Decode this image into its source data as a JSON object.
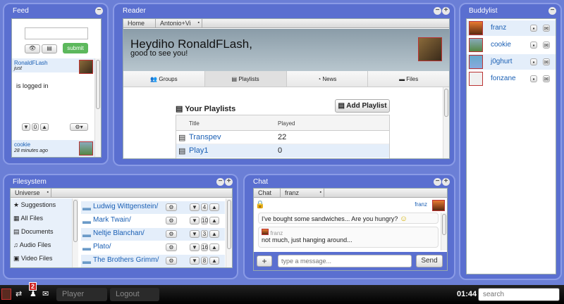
{
  "feed": {
    "title": "Feed",
    "submit": "submit",
    "items": [
      {
        "user": "RonaldFLash",
        "time": "just",
        "text": "is logged in",
        "likes": "0"
      },
      {
        "user": "cookie",
        "time": "28 minutes ago"
      }
    ]
  },
  "reader": {
    "title": "Reader",
    "tabs": [
      "Home",
      "Antonio+Vi"
    ],
    "greeting": "Heydiho RonaldFLash,",
    "sub": "good to see you!",
    "nav": [
      "Groups",
      "Playlists",
      "News",
      "Files"
    ],
    "section": "Your Playlists",
    "add": "Add Playlist",
    "cols": [
      "Title",
      "Played"
    ],
    "rows": [
      {
        "title": "Transpev",
        "played": "22"
      },
      {
        "title": "Play1",
        "played": "0"
      }
    ]
  },
  "buddylist": {
    "title": "Buddylist",
    "buddies": [
      "franz",
      "cookie",
      "j0ghurt",
      "fonzane"
    ]
  },
  "filesystem": {
    "title": "Filesystem",
    "tab": "Universe",
    "side": [
      "Suggestions",
      "All Files",
      "Documents",
      "Audio Files",
      "Video Files"
    ],
    "folders": [
      {
        "name": "Ludwig Wittgenstein/",
        "count": "4"
      },
      {
        "name": "Mark Twain/",
        "count": "10"
      },
      {
        "name": "Neltje Blanchan/",
        "count": "3"
      },
      {
        "name": "Plato/",
        "count": "16"
      },
      {
        "name": "The Brothers Grimm/",
        "count": "8"
      }
    ]
  },
  "chat": {
    "title": "Chat",
    "tabs": [
      "Chat",
      "franz"
    ],
    "user": "franz",
    "msgs": [
      {
        "text": "I've bought some sandwiches... Are you hungry?",
        "smile": "☺"
      },
      {
        "user": "franz",
        "text": "not much, just hanging around..."
      }
    ],
    "placeholder": "type a message...",
    "send": "Send"
  },
  "taskbar": {
    "badge": "2",
    "player": "Player",
    "logout": "Logout",
    "clock": "01:44",
    "search": "search"
  }
}
